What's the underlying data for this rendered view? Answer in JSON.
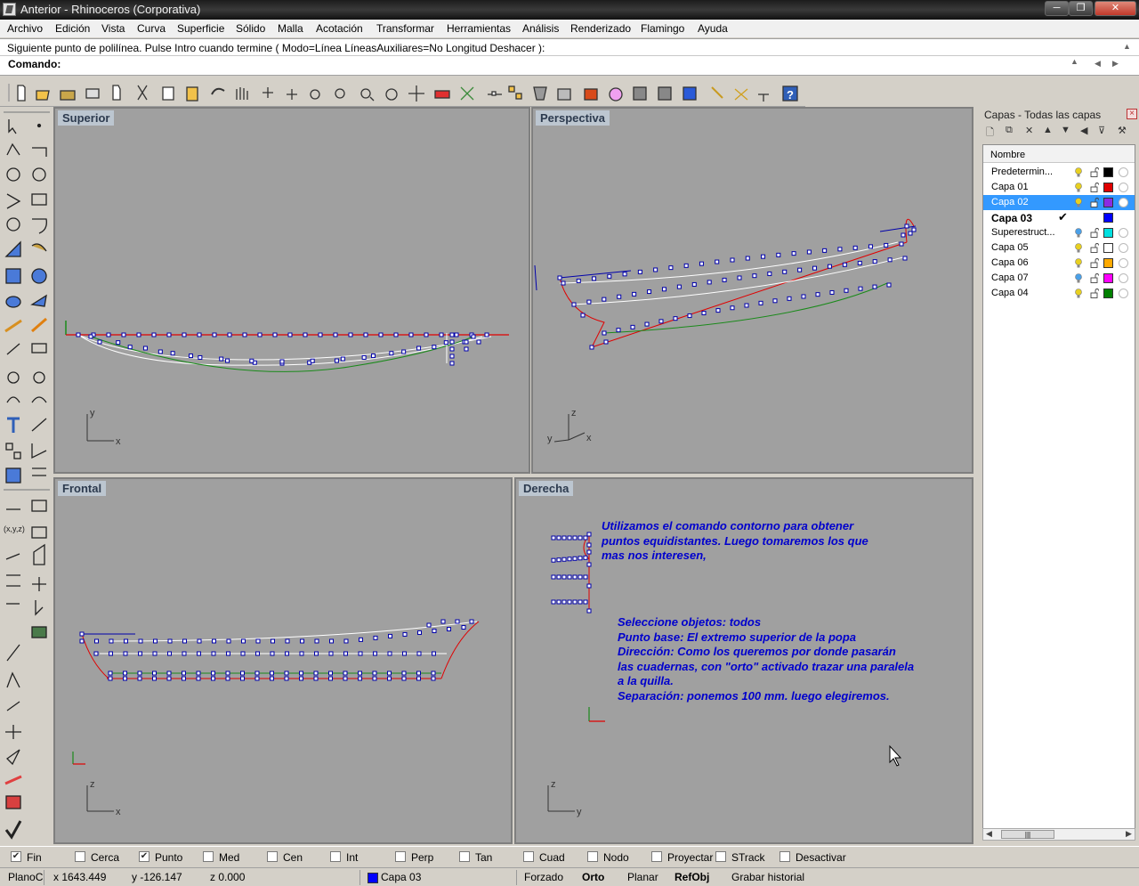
{
  "window": {
    "title": "Anterior - Rhinoceros (Corporativa)",
    "min_glyph": "─",
    "max_glyph": "❐",
    "close_glyph": "✕"
  },
  "menu": [
    "Archivo",
    "Edición",
    "Vista",
    "Curva",
    "Superficie",
    "Sólido",
    "Malla",
    "Acotación",
    "Transformar",
    "Herramientas",
    "Análisis",
    "Renderizado",
    "Flamingo",
    "Ayuda"
  ],
  "command": {
    "history": "Siguiente punto de polilínea. Pulse Intro cuando termine ( Modo=Línea  LíneasAuxiliares=No  Longitud  Deshacer ):",
    "prompt": "Comando:",
    "value": ""
  },
  "toolbar_icons": [
    "new-icon",
    "open-icon",
    "save-icon",
    "print-icon",
    "import-icon",
    "cut-icon",
    "copy-icon",
    "paste-icon",
    "undo-icon",
    "pan-icon",
    "rotate-view-icon",
    "zoom-icon",
    "zoom-window-icon",
    "zoom-extents-icon",
    "zoom-selected-icon",
    "4-viewports-icon",
    "cplane-icon",
    "shade-icon",
    "render-icon",
    "grid-icon",
    "point-icon",
    "osnap-icon",
    "select-icon",
    "material-icon",
    "lights-icon",
    "environment-icon",
    "camera-icon",
    "options-icon",
    "help-icon"
  ],
  "viewports": {
    "top": {
      "label": "Superior",
      "axes": [
        "y",
        "x"
      ]
    },
    "perspective": {
      "label": "Perspectiva",
      "axes": [
        "z",
        "y",
        "x"
      ]
    },
    "front": {
      "label": "Frontal",
      "axes": [
        "z",
        "x"
      ]
    },
    "right": {
      "label": "Derecha",
      "axes": [
        "z",
        "y"
      ],
      "note1": [
        "Utilizamos el comando contorno para obtener",
        "puntos equidistantes. Luego tomaremos los que",
        "mas nos interesen,"
      ],
      "note2": [
        "Seleccione objetos: todos",
        "Punto base: El extremo superior de la popa",
        "Dirección: Como  los queremos por donde pasarán",
        "las cuadernas, con \"orto\" activado trazar una paralela",
        "a la quilla.",
        "Separación: ponemos 100 mm. luego elegiremos."
      ]
    }
  },
  "layers_panel": {
    "title": "Capas - Todas las capas",
    "column_name": "Nombre",
    "rows": [
      {
        "name": "Predetermin...",
        "color": "#000000",
        "bulb": "#e8d020",
        "selected": false,
        "current": false
      },
      {
        "name": "Capa 01",
        "color": "#e00000",
        "bulb": "#e8d020",
        "selected": false,
        "current": false
      },
      {
        "name": "Capa 02",
        "color": "#8a2be2",
        "bulb": "#e8d020",
        "selected": true,
        "current": false
      },
      {
        "name": "Capa 03",
        "color": "#0000ff",
        "bulb": "",
        "selected": false,
        "current": true,
        "check": "✔"
      },
      {
        "name": "Superestruct...",
        "color": "#00e0e0",
        "bulb": "#4aa0e8",
        "selected": false,
        "current": false
      },
      {
        "name": "Capa 05",
        "color": "#ffffff",
        "bulb": "#e8d020",
        "selected": false,
        "current": false
      },
      {
        "name": "Capa 06",
        "color": "#ffaa00",
        "bulb": "#e8d020",
        "selected": false,
        "current": false
      },
      {
        "name": "Capa 07",
        "color": "#ff00ff",
        "bulb": "#4aa0e8",
        "selected": false,
        "current": false
      },
      {
        "name": "Capa 04",
        "color": "#008000",
        "bulb": "#e8d020",
        "selected": false,
        "current": false
      }
    ]
  },
  "osnaps": [
    {
      "label": "Fin",
      "checked": true
    },
    {
      "label": "Cerca",
      "checked": false
    },
    {
      "label": "Punto",
      "checked": true
    },
    {
      "label": "Med",
      "checked": false
    },
    {
      "label": "Cen",
      "checked": false
    },
    {
      "label": "Int",
      "checked": false
    },
    {
      "label": "Perp",
      "checked": false
    },
    {
      "label": "Tan",
      "checked": false
    },
    {
      "label": "Cuad",
      "checked": false
    },
    {
      "label": "Nodo",
      "checked": false
    },
    {
      "label": "Proyectar",
      "checked": false
    },
    {
      "label": "STrack",
      "checked": false
    },
    {
      "label": "Desactivar",
      "checked": false
    }
  ],
  "status": {
    "plane": "PlanoC",
    "x": "x 1643.449",
    "y": "y -126.147",
    "z": "z 0.000",
    "layer": "Capa 03",
    "layer_color": "#0000ff",
    "forzado": "Forzado",
    "orto": "Orto",
    "planar": "Planar",
    "refobj": "RefObj",
    "history": "Grabar historial"
  },
  "colors": {
    "viewport_bg": "#a0a0a0",
    "viewport_label_bg": "#bcc6d0",
    "curve_red": "#e00000",
    "curve_green": "#1a8a1a",
    "curve_white": "#ffffff",
    "points_blue": "#0000aa",
    "note_blue": "#0000cd",
    "selection": "#3399ff"
  }
}
